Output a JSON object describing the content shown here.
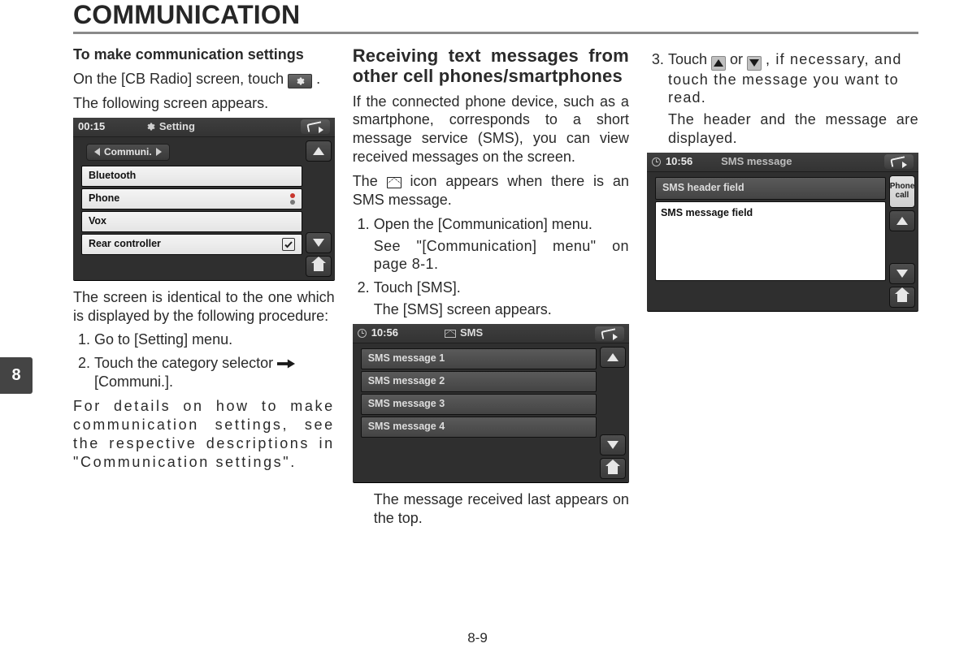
{
  "page": {
    "title": "COMMUNICATION",
    "chapter_tab": "8",
    "number": "8-9"
  },
  "col1": {
    "heading": "To make communication settings",
    "intro_a": "On the [CB Radio] screen, touch ",
    "intro_b": ".",
    "intro2": "The following screen appears.",
    "after_shot": "The screen is identical to the one which is displayed by the following procedure:",
    "steps": {
      "s1": "Go to [Setting] menu.",
      "s2a": "Touch the category selector ",
      "s2b": " [Communi.]."
    },
    "outro": "For details on how to make communication settings, see the respective descriptions in \"Communication settings\"."
  },
  "shot1": {
    "clock": "00:15",
    "title_icon": "gear",
    "title": "Setting",
    "selector": "Communi.",
    "items": [
      "Bluetooth",
      "Phone",
      "Vox",
      "Rear controller"
    ]
  },
  "col2": {
    "heading": "Receiving text messages from other cell phones/smart­phones",
    "p1": "If the connected phone device, such as a smartphone, corresponds to a short message service (SMS), you can view received messages on the screen.",
    "p2a": "The ",
    "p2b": " icon appears when there is an SMS message.",
    "steps": {
      "s1": "Open the [Communication] menu.",
      "s1_after": "See \"[Communication] menu\" on page 8-1.",
      "s2": "Touch [SMS].",
      "s2_after": "The [SMS] screen appears."
    },
    "after_shot": "The message received last appears on the top."
  },
  "shot2": {
    "clock": "10:56",
    "title": "SMS",
    "items": [
      "SMS message 1",
      "SMS message 2",
      "SMS message 3",
      "SMS message 4"
    ]
  },
  "col3": {
    "s3a": "Touch ",
    "s3b": " or ",
    "s3c": " , if necessary, and touch the message you want to read.",
    "s3_after": "The header and the message are displayed."
  },
  "shot3": {
    "clock": "10:56",
    "title": "SMS message",
    "header_field": "SMS header field",
    "message_field": "SMS message field",
    "side_btn_l1": "Phone",
    "side_btn_l2": "call"
  }
}
